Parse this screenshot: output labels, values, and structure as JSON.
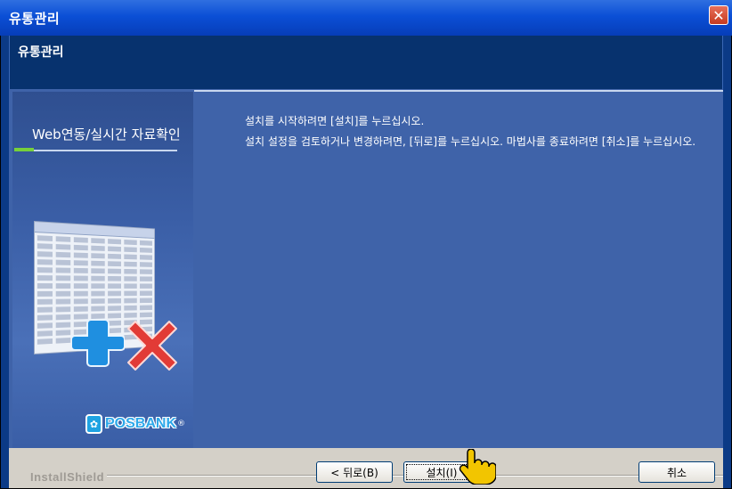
{
  "window": {
    "title": "유통관리",
    "close_symbol": "✕"
  },
  "header": {
    "title": "유통관리"
  },
  "side_panel": {
    "title": "Web연동/실시간 자료확인",
    "logo_text": "POSBANK",
    "logo_badge_text": "®"
  },
  "main": {
    "message1": "설치를 시작하려면 [설치]를 누르십시오.",
    "message2": "설치 설정을 검토하거나 변경하려면, [뒤로]를 누르십시오. 마법사를 종료하려면 [취소]를 누르십시오."
  },
  "footer": {
    "brand": "InstallShield",
    "back_label": "< 뒤로(B)",
    "install_label": "설치(I)",
    "cancel_label": "취소"
  },
  "colors": {
    "title_bar": "#0b4fd6",
    "content_bg": "#3f63a9",
    "plus_blue": "#1f8fe0",
    "x_red": "#e23b36"
  },
  "icons": [
    "close-icon",
    "plus-icon",
    "x-icon",
    "hand-cursor-icon"
  ]
}
